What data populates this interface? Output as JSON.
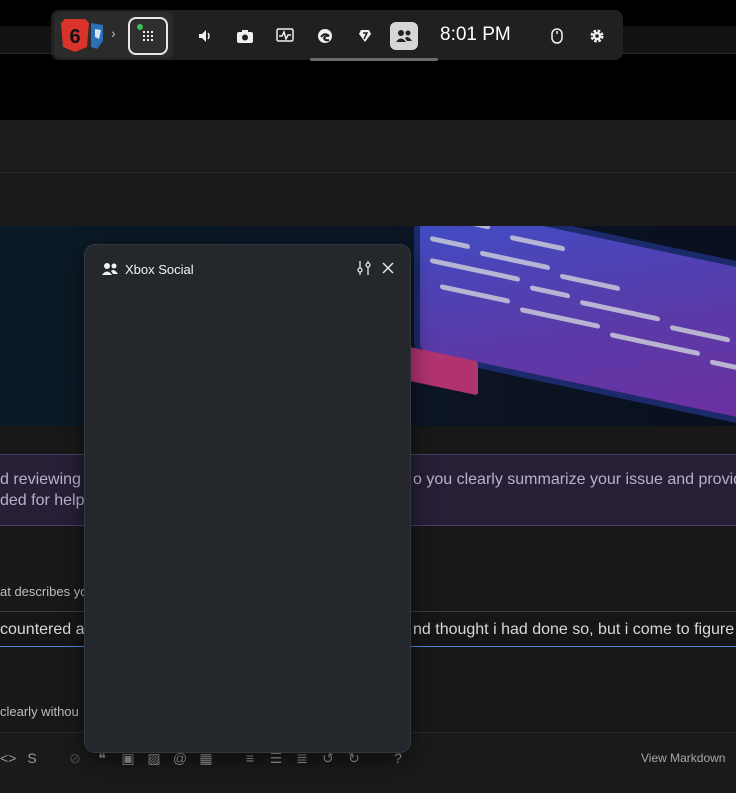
{
  "background": {
    "notice_line1_left": "d reviewing o",
    "notice_line1_right": "o you clearly summarize your issue and provide",
    "notice_line2_left": "ded for helpf",
    "field_label": "at describes yo",
    "input_left": "countered a v",
    "input_right": "nd thought i had done so, but i come to figure",
    "hint_text": "clearly withou",
    "view_markdown": "View Markdown"
  },
  "game_bar": {
    "time": "8:01 PM",
    "icons": [
      "widgets-icon",
      "volume-icon",
      "camera-icon",
      "performance-icon",
      "edge-icon",
      "capture-icon",
      "social-icon",
      "mouse-icon",
      "gear-icon"
    ]
  },
  "social_panel": {
    "title": "Xbox Social"
  },
  "colors": {
    "accent": "#4a8bd6",
    "panel_bg": "#24272b",
    "notice_bg": "#261f36"
  }
}
